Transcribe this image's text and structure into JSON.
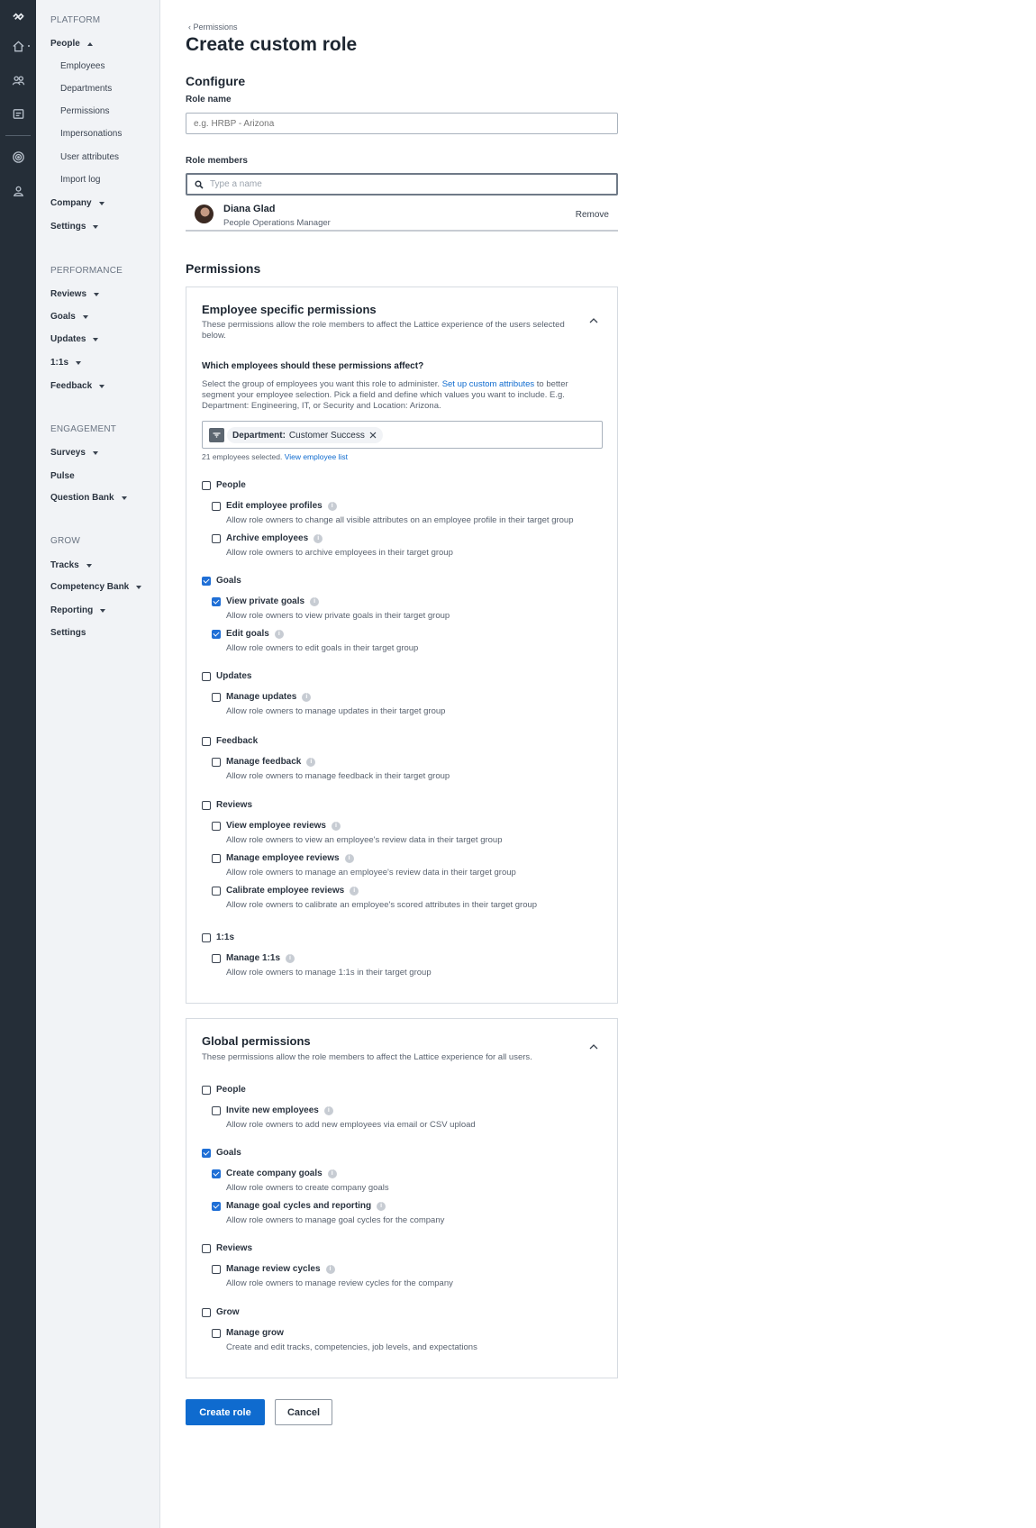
{
  "rail": {
    "icons": [
      "lattice-logo-icon",
      "home-icon",
      "people-icon",
      "document-icon",
      "target-icon",
      "grow-icon"
    ]
  },
  "nav": {
    "sections": {
      "platform": "PLATFORM",
      "performance": "PERFORMANCE",
      "engagement": "ENGAGEMENT",
      "grow": "GROW"
    },
    "platform_items": {
      "people": "People",
      "people_sub": [
        "Employees",
        "Departments",
        "Permissions",
        "Impersonations",
        "User attributes",
        "Import log"
      ],
      "company": "Company",
      "settings": "Settings"
    },
    "performance_items": [
      "Reviews",
      "Goals",
      "Updates",
      "1:1s",
      "Feedback"
    ],
    "engagement_items": [
      "Surveys",
      "Pulse",
      "Question Bank"
    ],
    "grow_items": [
      "Tracks",
      "Competency Bank",
      "Reporting",
      "Settings"
    ]
  },
  "page": {
    "breadcrumb": "‹ Permissions",
    "title": "Create custom role",
    "configure_heading": "Configure",
    "role_name_label": "Role name",
    "role_name_placeholder": "e.g. HRBP - Arizona",
    "role_members_label": "Role members",
    "member_search_placeholder": "Type a name",
    "member": {
      "name": "Diana Glad",
      "title": "People Operations Manager",
      "remove": "Remove"
    },
    "permissions_heading": "Permissions"
  },
  "employee_card": {
    "title": "Employee specific permissions",
    "subtitle_line1": "These permissions allow the role members to affect the Lattice experience of the users selected",
    "subtitle_line2": "below.",
    "question": "Which employees should these permissions affect?",
    "help_line1_pre": "Select the group of employees you want this role to administer.",
    "help_link": "Set up custom attributes",
    "help_line1_post": "to better",
    "help_line2": "segment your employee selection. Pick a field and define which values you want to include. E.g.",
    "help_line3": "Department: Engineering, IT, or Security and Location: Arizona.",
    "filter_key": "Department:",
    "filter_value": "Customer Success",
    "selected_count": "21 employees selected.",
    "view_list": "View employee list",
    "groups": [
      {
        "label": "People",
        "checked": false,
        "perms": [
          {
            "label": "Edit employee profiles",
            "desc": "Allow role owners to change all visible attributes on an employee profile in their target group",
            "checked": false
          },
          {
            "label": "Archive employees",
            "desc": "Allow role owners to archive employees in their target group",
            "checked": false
          }
        ]
      },
      {
        "label": "Goals",
        "checked": true,
        "perms": [
          {
            "label": "View private goals",
            "desc": "Allow role owners to view private goals in their target group",
            "checked": true
          },
          {
            "label": "Edit goals",
            "desc": "Allow role owners to edit goals in their target group",
            "checked": true
          }
        ]
      },
      {
        "label": "Updates",
        "checked": false,
        "perms": [
          {
            "label": "Manage updates",
            "desc": "Allow role owners to manage updates in their target group",
            "checked": false
          }
        ]
      },
      {
        "label": "Feedback",
        "checked": false,
        "perms": [
          {
            "label": "Manage feedback",
            "desc": "Allow role owners to manage feedback in their target group",
            "checked": false
          }
        ]
      },
      {
        "label": "Reviews",
        "checked": false,
        "perms": [
          {
            "label": "View employee reviews",
            "desc": "Allow role owners to view an employee's review data in their target group",
            "checked": false
          },
          {
            "label": "Manage employee reviews",
            "desc": "Allow role owners to manage an employee's review data in their target group",
            "checked": false
          },
          {
            "label": "Calibrate employee reviews",
            "desc": "Allow role owners to calibrate an employee's scored attributes in their target group",
            "checked": false
          }
        ]
      },
      {
        "label": "1:1s",
        "checked": false,
        "perms": [
          {
            "label": "Manage 1:1s",
            "desc": "Allow role owners to manage 1:1s in their target group",
            "checked": false
          }
        ]
      }
    ]
  },
  "global_card": {
    "title": "Global permissions",
    "subtitle": "These permissions allow the role members to affect the Lattice experience for all users.",
    "groups": [
      {
        "label": "People",
        "checked": false,
        "perms": [
          {
            "label": "Invite new employees",
            "desc": "Allow role owners to add new employees via email or CSV upload",
            "checked": false,
            "info": true
          }
        ]
      },
      {
        "label": "Goals",
        "checked": true,
        "perms": [
          {
            "label": "Create company goals",
            "desc": "Allow role owners to create company goals",
            "checked": true,
            "info": true
          },
          {
            "label": "Manage goal cycles and reporting",
            "desc": "Allow role owners to manage goal cycles for the company",
            "checked": true,
            "info": true
          }
        ]
      },
      {
        "label": "Reviews",
        "checked": false,
        "perms": [
          {
            "label": "Manage review cycles",
            "desc": "Allow role owners to manage review cycles for the company",
            "checked": false,
            "info": true
          }
        ]
      },
      {
        "label": "Grow",
        "checked": false,
        "perms": [
          {
            "label": "Manage grow",
            "desc": "Create and edit tracks, competencies, job levels, and expectations",
            "checked": false,
            "info": false
          }
        ]
      }
    ]
  },
  "actions": {
    "create": "Create role",
    "cancel": "Cancel"
  },
  "colors": {
    "rail_bg": "#252e38",
    "nav_bg": "#f1f3f6",
    "accent": "#0f6bcf"
  }
}
